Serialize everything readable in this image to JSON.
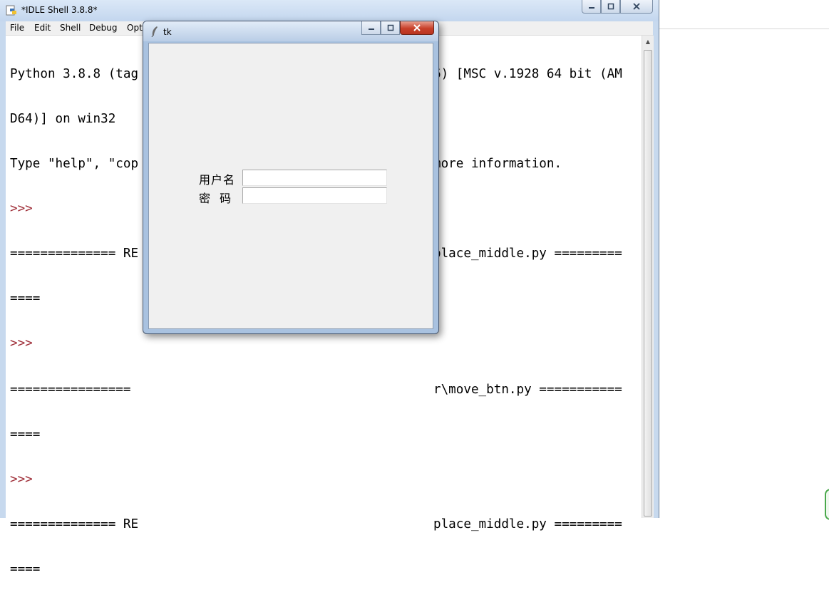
{
  "idle": {
    "title": "*IDLE Shell 3.8.8*",
    "menu": [
      "File",
      "Edit",
      "Shell",
      "Debug",
      "Opt"
    ],
    "lines": [
      {
        "text": "Python 3.8.8 (tag",
        "prompt": false
      },
      {
        "text": "D64)] on win32",
        "prompt": false
      },
      {
        "text": "Type \"help\", \"cop",
        "prompt": false
      },
      {
        "text": ">>>",
        "prompt": true
      },
      {
        "text": "============== RE",
        "prompt": false
      },
      {
        "text": "====",
        "prompt": false
      },
      {
        "text": ">>>",
        "prompt": true
      },
      {
        "text": "================",
        "prompt": false
      },
      {
        "text": "====",
        "prompt": false
      },
      {
        "text": ">>>",
        "prompt": true
      },
      {
        "text": "============== RE",
        "prompt": false
      },
      {
        "text": "====",
        "prompt": false
      }
    ],
    "right_fragments": [
      {
        "line": 0,
        "text": "6) [MSC v.1928 64 bit (AM"
      },
      {
        "line": 2,
        "text": "more information."
      },
      {
        "line": 4,
        "text": "place_middle.py ========="
      },
      {
        "line": 7,
        "text": "r\\move_btn.py ==========="
      },
      {
        "line": 10,
        "text": "place_middle.py ========="
      }
    ]
  },
  "tk": {
    "title": "tk",
    "username_label": "用户名",
    "password_label": "密  码",
    "username_value": "",
    "password_value": ""
  }
}
